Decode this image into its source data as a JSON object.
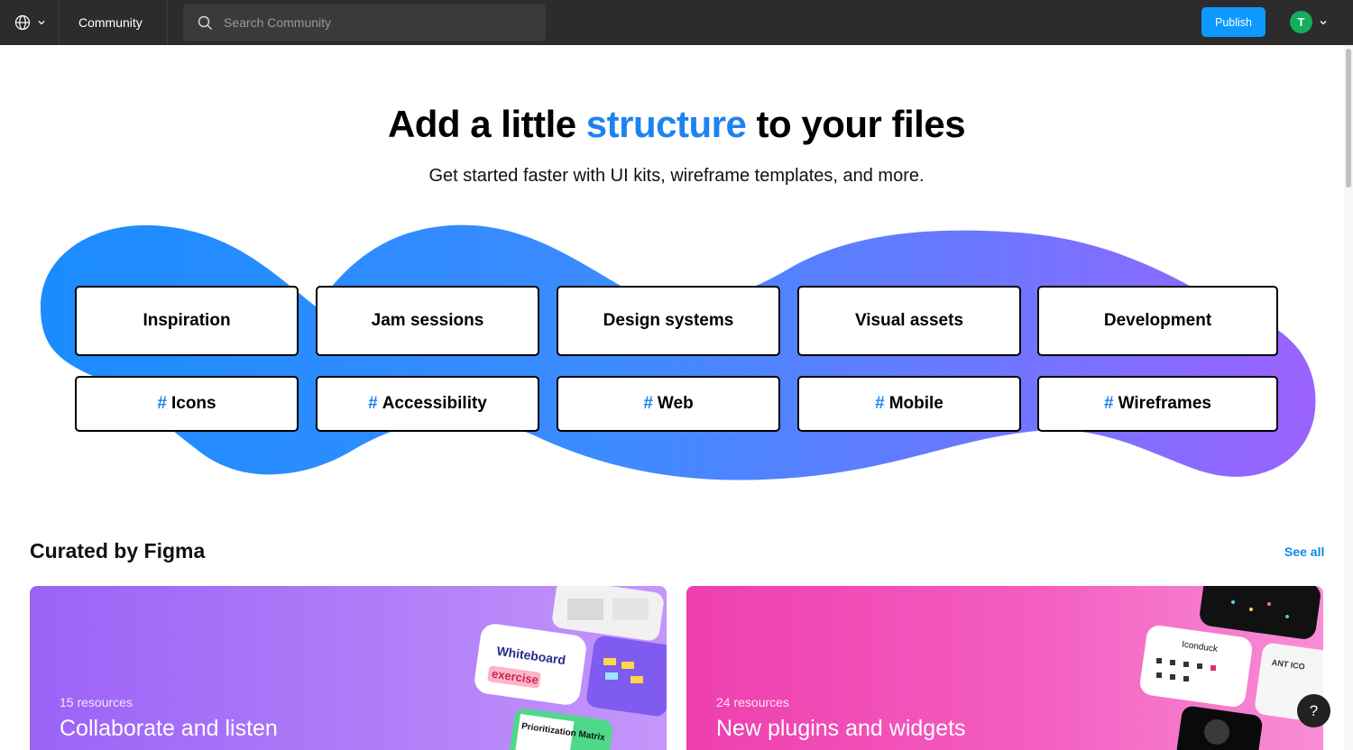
{
  "topbar": {
    "community_label": "Community",
    "search_placeholder": "Search Community",
    "publish_label": "Publish",
    "avatar_initial": "T",
    "avatar_color": "#14ae5c",
    "icons": [
      "globe-icon",
      "chevron-down-icon",
      "search-icon"
    ]
  },
  "hero": {
    "title_before": "Add a little ",
    "title_accent": "structure",
    "title_after": " to your files",
    "subtitle": "Get started faster with UI kits, wireframe templates, and more.",
    "accent_color": "#1e83f0"
  },
  "categories": [
    "Inspiration",
    "Jam sessions",
    "Design systems",
    "Visual assets",
    "Development"
  ],
  "tags": {
    "hash": "#",
    "items": [
      "Icons",
      "Accessibility",
      "Web",
      "Mobile",
      "Wireframes"
    ]
  },
  "curated": {
    "title": "Curated by Figma",
    "see_all": "See all",
    "cards": [
      {
        "count": "15 resources",
        "title": "Collaborate and listen",
        "art_text_1": "Whiteboard",
        "art_text_2": "exercise",
        "art_text_3": "Prioritization Matrix"
      },
      {
        "count": "24 resources",
        "title": "New plugins and widgets",
        "art_text_1": "Iconduck",
        "art_text_2": "ANT ICO"
      }
    ]
  },
  "help_label": "?"
}
